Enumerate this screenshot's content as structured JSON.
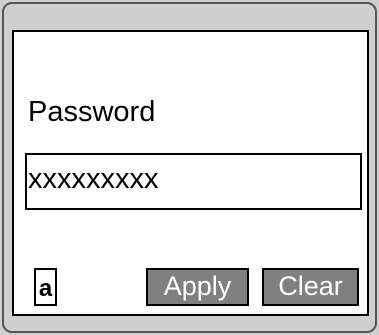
{
  "window": {
    "title": ""
  },
  "password": {
    "label": "Password",
    "value": "xxxxxxxxx"
  },
  "input_mode": {
    "value": "a"
  },
  "buttons": {
    "apply_label": "Apply",
    "clear_label": "Clear"
  },
  "colors": {
    "frame": "#cfcfcf",
    "screen": "#ffffff",
    "button": "#808080",
    "border": "#000000"
  }
}
